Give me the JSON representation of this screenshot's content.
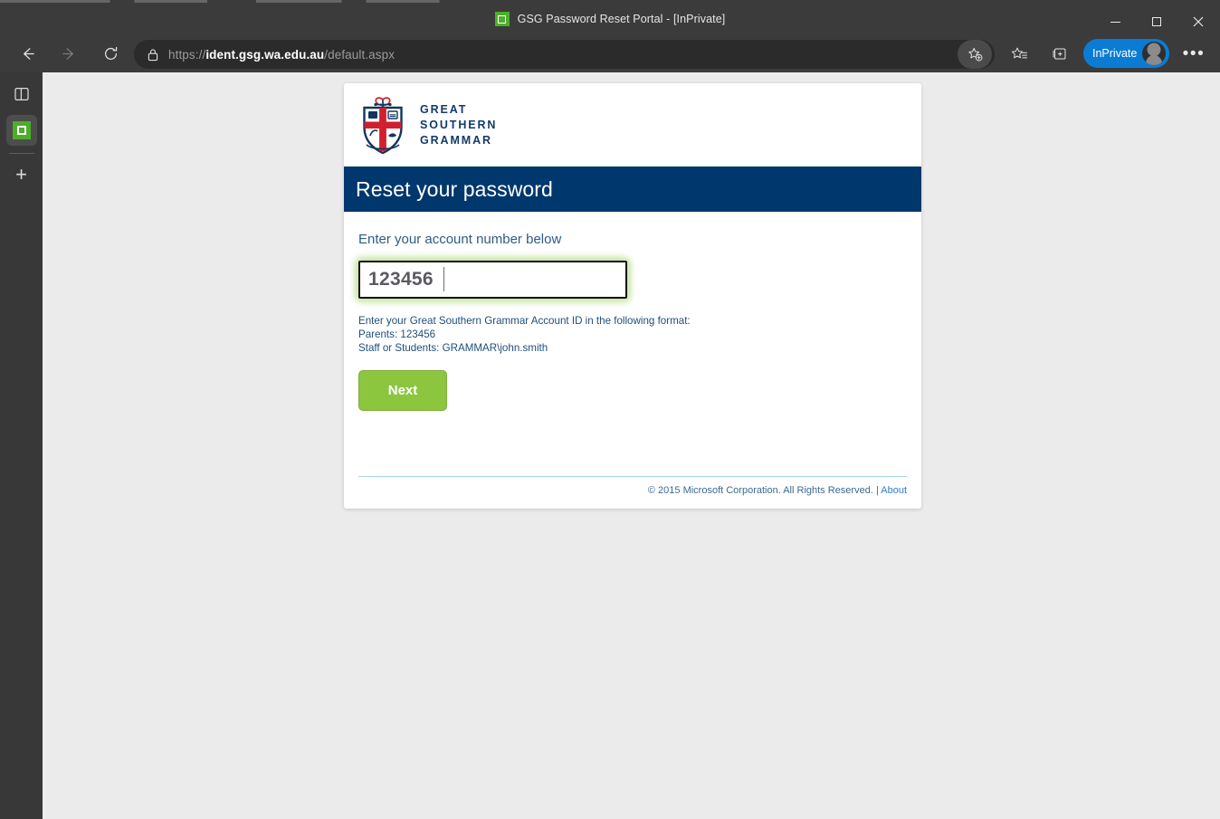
{
  "window": {
    "title": "GSG Password Reset Portal - [InPrivate]",
    "favicon_name": "gsg-green-favicon",
    "controls": {
      "minimize": "Minimize",
      "maximize": "Maximize",
      "close": "Close"
    }
  },
  "toolbar": {
    "back": "Back",
    "forward": "Forward",
    "reload": "Refresh",
    "lock_icon": "lock-icon",
    "url_prefix": "https://",
    "url_domain": "ident.gsg.wa.edu.au",
    "url_path": "/default.aspx",
    "url_full": "https://ident.gsg.wa.edu.au/default.aspx",
    "add_favorite": "Add this page to favorites",
    "favorites": "Favorites",
    "collections": "Collections",
    "inprivate_label": "InPrivate",
    "more": "Settings and more"
  },
  "tab_rail": {
    "tab_list": "Tab actions menu",
    "active_tab": "GSG Password Reset Portal",
    "new_tab": "+"
  },
  "page": {
    "brand": {
      "line1": "GREAT",
      "line2": "SOUTHERN",
      "line3": "GRAMMAR",
      "logo": "gsg-crest-logo"
    },
    "header_title": "Reset your password",
    "prompt": "Enter your account number below",
    "account_input": {
      "value": "123456",
      "placeholder": ""
    },
    "help": {
      "line1": "Enter your Great Southern Grammar Account ID in the following format:",
      "line2": "Parents: 123456",
      "line3": "Staff or Students: GRAMMAR\\john.smith"
    },
    "next_label": "Next",
    "footer": {
      "copyright": "© 2015 Microsoft Corporation. All Rights Reserved.",
      "separator": "|",
      "about_label": "About"
    }
  },
  "colors": {
    "brand_navy": "#00376d",
    "brand_red": "#d0202e",
    "accent_green": "#8cc63f",
    "focus_glow": "#96cd50",
    "link_blue": "#2f7fc1",
    "inprivate_blue": "#0a7cd4",
    "page_background": "#ebebeb"
  }
}
